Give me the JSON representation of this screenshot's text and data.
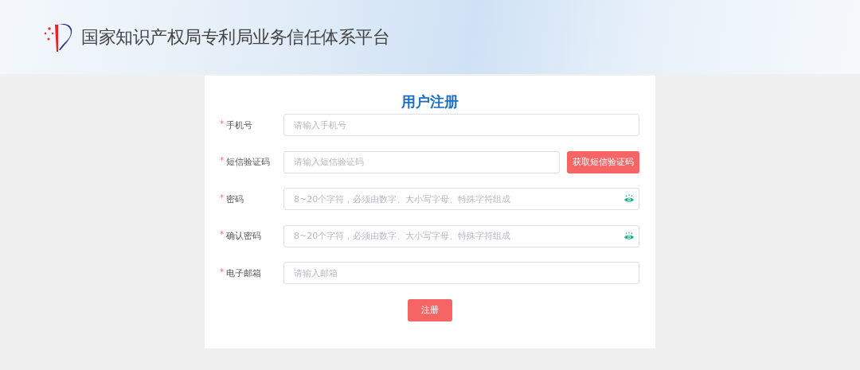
{
  "header": {
    "title": "国家知识产权局专利局业务信任体系平台"
  },
  "form": {
    "title": "用户注册",
    "fields": [
      {
        "kind": "text",
        "mark": "*",
        "label": "手机号",
        "placeholder": "请输入手机号"
      },
      {
        "kind": "code",
        "mark": "*",
        "label": "短信验证码",
        "placeholder": "请输入短信验证码",
        "button": "获取短信验证码"
      },
      {
        "kind": "password",
        "mark": "*",
        "label": "密码",
        "placeholder": "8~20个字符，必须由数字、大小写字母、特殊字符组成"
      },
      {
        "kind": "password",
        "mark": "*",
        "label": "确认密码",
        "placeholder": "8~20个字符，必须由数字、大小写字母、特殊字符组成"
      },
      {
        "kind": "text",
        "mark": "*",
        "label": "电子邮箱",
        "placeholder": "请输入邮箱"
      }
    ],
    "submit": "注册"
  }
}
